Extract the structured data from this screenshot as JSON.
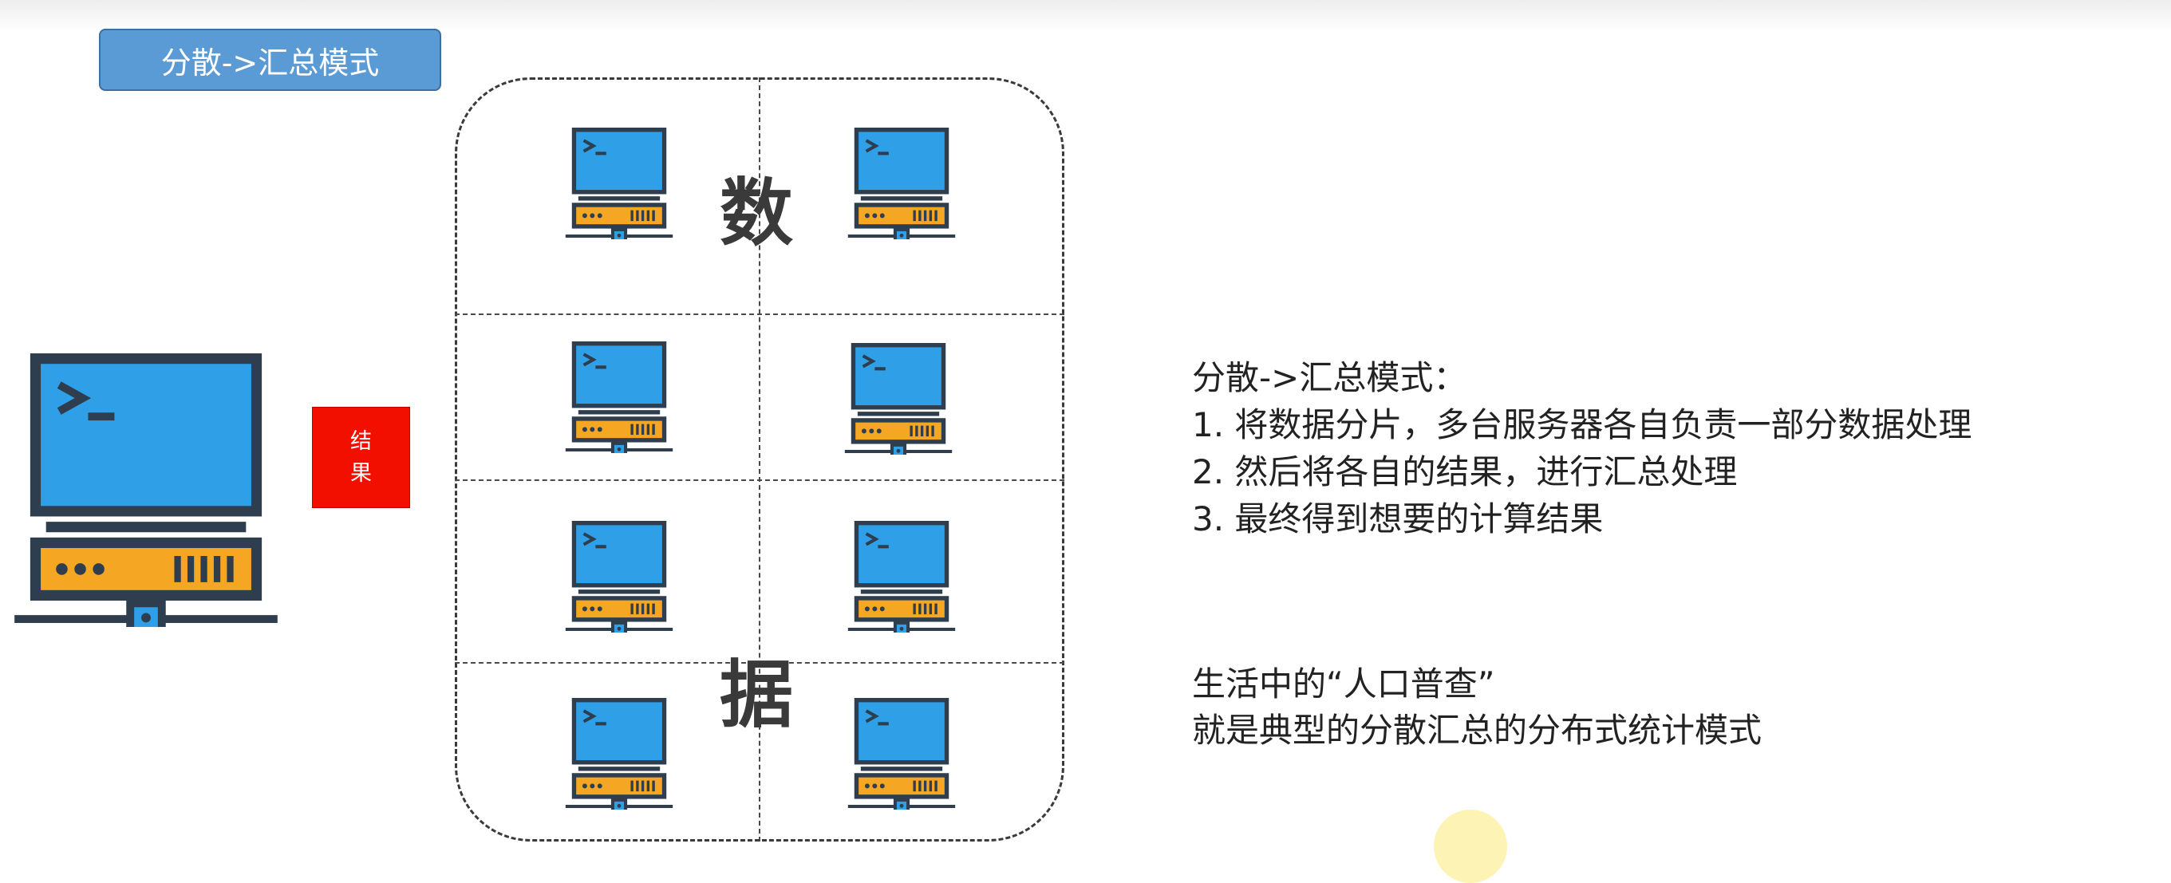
{
  "title_badge": "分散->汇总模式",
  "cluster": {
    "glyph_top": "数",
    "glyph_bottom": "据"
  },
  "result_box": {
    "line1": "结",
    "line2": "果"
  },
  "description": {
    "heading": "分散->汇总模式：",
    "step1": "1. 将数据分片，多台服务器各自负责一部分数据处理",
    "step2": "2. 然后将各自的结果，进行汇总处理",
    "step3": "3. 最终得到想要的计算结果",
    "example_line1": "生活中的“人口普查”",
    "example_line2": "就是典型的分散汇总的分布式统计模式"
  },
  "icons": {
    "main": "computer-server-icon",
    "node": "computer-server-icon"
  },
  "colors": {
    "badge": "#5b9bd5",
    "screen": "#2fa0e8",
    "server_base": "#f5a623",
    "outline": "#2e3e4f",
    "result": "#f20f00"
  }
}
